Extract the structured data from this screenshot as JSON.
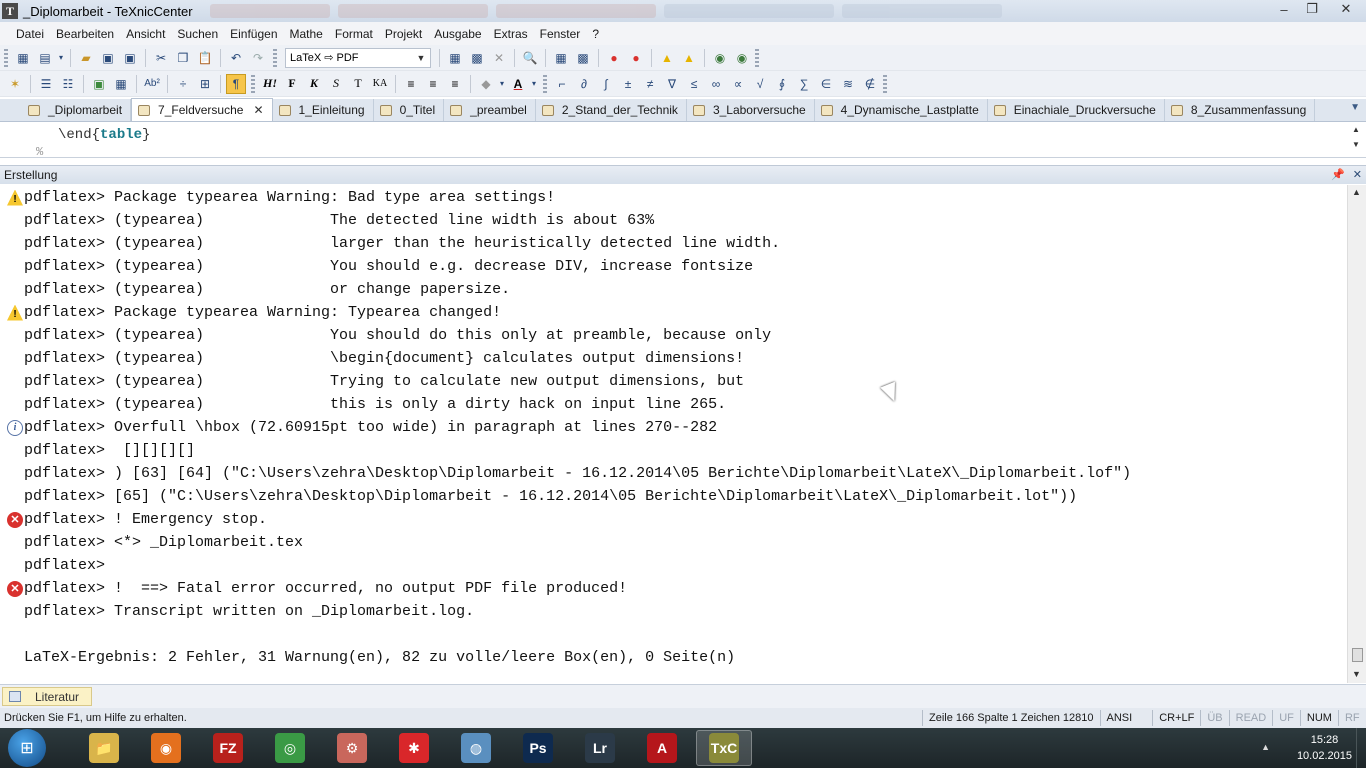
{
  "window": {
    "title": "_Diplomarbeit - TeXnicCenter",
    "app_icon_letter": "T",
    "controls": [
      "–",
      "❐",
      "✕"
    ]
  },
  "menu": [
    "Datei",
    "Bearbeiten",
    "Ansicht",
    "Suchen",
    "Einfügen",
    "Mathe",
    "Format",
    "Projekt",
    "Ausgabe",
    "Extras",
    "Fenster",
    "?"
  ],
  "toolbar": {
    "output_profile": "LaTeX ⇨ PDF",
    "format_buttons": [
      "H!",
      "F",
      "K",
      "S",
      "T",
      "KA"
    ]
  },
  "tabs": [
    {
      "label": "_Diplomarbeit",
      "active": false
    },
    {
      "label": "7_Feldversuche",
      "active": true
    },
    {
      "label": "1_Einleitung",
      "active": false
    },
    {
      "label": "0_Titel",
      "active": false
    },
    {
      "label": "_preambel",
      "active": false
    },
    {
      "label": "2_Stand_der_Technik",
      "active": false
    },
    {
      "label": "3_Laborversuche",
      "active": false
    },
    {
      "label": "4_Dynamische_Lastplatte",
      "active": false
    },
    {
      "label": "Einachiale_Druckversuche",
      "active": false
    },
    {
      "label": "8_Zusammenfassung",
      "active": false
    }
  ],
  "editor": {
    "line_prefix": "\\end{",
    "line_keyword": "table",
    "line_suffix": "}",
    "next_line_fragment": "%"
  },
  "output_panel": {
    "title": "Erstellung",
    "lines": [
      {
        "icon": "warning",
        "text": "pdflatex> Package typearea Warning: Bad type area settings!"
      },
      {
        "icon": "none",
        "text": "pdflatex> (typearea)              The detected line width is about 63%"
      },
      {
        "icon": "none",
        "text": "pdflatex> (typearea)              larger than the heuristically detected line width."
      },
      {
        "icon": "none",
        "text": "pdflatex> (typearea)              You should e.g. decrease DIV, increase fontsize"
      },
      {
        "icon": "none",
        "text": "pdflatex> (typearea)              or change papersize."
      },
      {
        "icon": "warning",
        "text": "pdflatex> Package typearea Warning: Typearea changed!"
      },
      {
        "icon": "none",
        "text": "pdflatex> (typearea)              You should do this only at preamble, because only"
      },
      {
        "icon": "none",
        "text": "pdflatex> (typearea)              \\begin{document} calculates output dimensions!"
      },
      {
        "icon": "none",
        "text": "pdflatex> (typearea)              Trying to calculate new output dimensions, but"
      },
      {
        "icon": "none",
        "text": "pdflatex> (typearea)              this is only a dirty hack on input line 265."
      },
      {
        "icon": "info",
        "text": "pdflatex> Overfull \\hbox (72.60915pt too wide) in paragraph at lines 270--282"
      },
      {
        "icon": "none",
        "text": "pdflatex>  [][][][]"
      },
      {
        "icon": "none",
        "text": "pdflatex> ) [63] [64] (\"C:\\Users\\zehra\\Desktop\\Diplomarbeit - 16.12.2014\\05 Berichte\\Diplomarbeit\\LateX\\_Diplomarbeit.lof\")"
      },
      {
        "icon": "none",
        "text": "pdflatex> [65] (\"C:\\Users\\zehra\\Desktop\\Diplomarbeit - 16.12.2014\\05 Berichte\\Diplomarbeit\\LateX\\_Diplomarbeit.lot\"))"
      },
      {
        "icon": "error",
        "text": "pdflatex> ! Emergency stop."
      },
      {
        "icon": "none",
        "text": "pdflatex> <*> _Diplomarbeit.tex"
      },
      {
        "icon": "none",
        "text": "pdflatex>"
      },
      {
        "icon": "error",
        "text": "pdflatex> !  ==> Fatal error occurred, no output PDF file produced!"
      },
      {
        "icon": "none",
        "text": "pdflatex> Transcript written on _Diplomarbeit.log."
      },
      {
        "icon": "none",
        "text": ""
      },
      {
        "icon": "none",
        "text": "LaTeX-Ergebnis: 2 Fehler, 31 Warnung(en), 82 zu volle/leere Box(en), 0 Seite(n)"
      }
    ]
  },
  "bottom_tab": {
    "label": "Literatur"
  },
  "status": {
    "help": "Drücken Sie F1, um Hilfe zu erhalten.",
    "position": "Zeile 166 Spalte 1 Zeichen 12810",
    "encoding": "ANSI",
    "line_ending": "CR+LF",
    "overwrite": "ÜB",
    "readonly": "READ",
    "uf": "UF",
    "num": "NUM",
    "rf": "RF"
  },
  "taskbar": {
    "apps": [
      {
        "name": "explorer",
        "glyph": "📁",
        "color": "#d9b44a"
      },
      {
        "name": "firefox",
        "glyph": "◉",
        "color": "#e4701e"
      },
      {
        "name": "filezilla",
        "glyph": "FZ",
        "color": "#b8211c"
      },
      {
        "name": "chrome",
        "glyph": "◎",
        "color": "#3a9a45"
      },
      {
        "name": "app",
        "glyph": "⚙",
        "color": "#c9675c"
      },
      {
        "name": "paint-app",
        "glyph": "✱",
        "color": "#d9272a"
      },
      {
        "name": "cd-burner",
        "glyph": "◍",
        "color": "#5a8fbf"
      },
      {
        "name": "photoshop",
        "glyph": "Ps",
        "color": "#0e2a4f"
      },
      {
        "name": "lightroom",
        "glyph": "Lr",
        "color": "#2b3a48"
      },
      {
        "name": "autocad",
        "glyph": "A",
        "color": "#b5161b"
      },
      {
        "name": "texniccenter",
        "glyph": "TxC",
        "color": "#8a8a3a"
      }
    ],
    "time": "15:28",
    "date": "10.02.2015"
  }
}
